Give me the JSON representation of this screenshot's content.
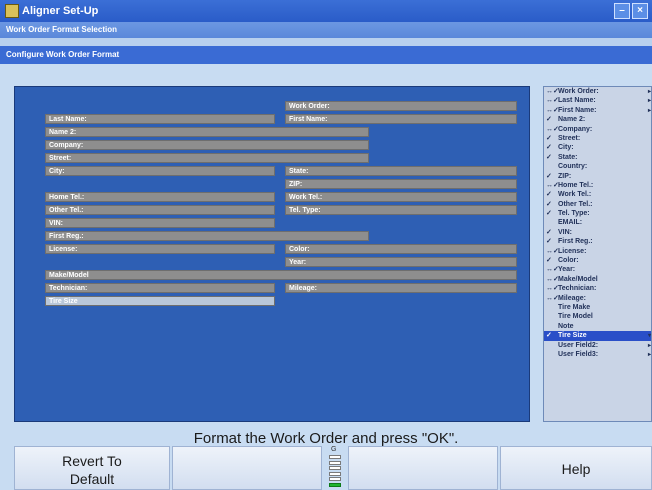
{
  "window": {
    "title": "Aligner Set-Up"
  },
  "header": {
    "section": "Work Order Format Selection",
    "subheader": "Configure Work Order Format"
  },
  "form_fields": {
    "work_order": "Work Order:",
    "last_name": "Last Name:",
    "first_name": "First Name:",
    "name2": "Name 2:",
    "company": "Company:",
    "street": "Street:",
    "city": "City:",
    "state": "State:",
    "zip": "ZIP:",
    "home_tel": "Home Tel.:",
    "work_tel": "Work Tel.:",
    "other_tel": "Other Tel.:",
    "tel_type": "Tel. Type:",
    "vin": "VIN:",
    "first_reg": "First Reg.:",
    "license": "License:",
    "color": "Color:",
    "year": "Year:",
    "make_model": "Make/Model",
    "technician": "Technician:",
    "mileage": "Mileage:",
    "tire_size": "Tire Size"
  },
  "field_list": [
    {
      "label": "Work Order:",
      "mark": "↔✓",
      "arrow": "▸"
    },
    {
      "label": "Last Name:",
      "mark": "↔✓",
      "arrow": "▸"
    },
    {
      "label": "First Name:",
      "mark": "↔✓",
      "arrow": "▸"
    },
    {
      "label": "Name 2:",
      "mark": "✓",
      "arrow": ""
    },
    {
      "label": "Company:",
      "mark": "↔✓",
      "arrow": ""
    },
    {
      "label": "Street:",
      "mark": "✓",
      "arrow": ""
    },
    {
      "label": "City:",
      "mark": "✓",
      "arrow": ""
    },
    {
      "label": "State:",
      "mark": "✓",
      "arrow": ""
    },
    {
      "label": "Country:",
      "mark": "",
      "arrow": ""
    },
    {
      "label": "ZIP:",
      "mark": "✓",
      "arrow": ""
    },
    {
      "label": "Home Tel.:",
      "mark": "↔✓",
      "arrow": ""
    },
    {
      "label": "Work Tel.:",
      "mark": "✓",
      "arrow": ""
    },
    {
      "label": "Other Tel.:",
      "mark": "✓",
      "arrow": ""
    },
    {
      "label": "Tel. Type:",
      "mark": "✓",
      "arrow": ""
    },
    {
      "label": "EMAIL:",
      "mark": "",
      "arrow": ""
    },
    {
      "label": "VIN:",
      "mark": "✓",
      "arrow": ""
    },
    {
      "label": "First Reg.:",
      "mark": "✓",
      "arrow": ""
    },
    {
      "label": "License:",
      "mark": "↔✓",
      "arrow": ""
    },
    {
      "label": "Color:",
      "mark": "✓",
      "arrow": ""
    },
    {
      "label": "Year:",
      "mark": "↔✓",
      "arrow": ""
    },
    {
      "label": "Make/Model",
      "mark": "↔✓",
      "arrow": ""
    },
    {
      "label": "Technician:",
      "mark": "↔✓",
      "arrow": ""
    },
    {
      "label": "Mileage:",
      "mark": "↔✓",
      "arrow": ""
    },
    {
      "label": "Tire Make",
      "mark": "",
      "arrow": ""
    },
    {
      "label": "Tire Model",
      "mark": "",
      "arrow": ""
    },
    {
      "label": "Note",
      "mark": "",
      "arrow": ""
    },
    {
      "label": "Tire Size",
      "mark": "✓",
      "arrow": "▾",
      "selected": true
    },
    {
      "label": "User Field2:",
      "mark": "",
      "arrow": "▸"
    },
    {
      "label": "User Field3:",
      "mark": "",
      "arrow": "▸"
    }
  ],
  "instruction": "Format the Work Order and press \"OK\".",
  "buttons": {
    "revert": "Revert To Default",
    "help": "Help"
  },
  "gauge": {
    "label": "G",
    "segments": 6,
    "filled_segments": 1
  },
  "colors": {
    "panel": "#2e5fb4",
    "field": "#8e8e8e",
    "selected": "#2a4fc8",
    "gauge_fill": "#1fb52f"
  }
}
